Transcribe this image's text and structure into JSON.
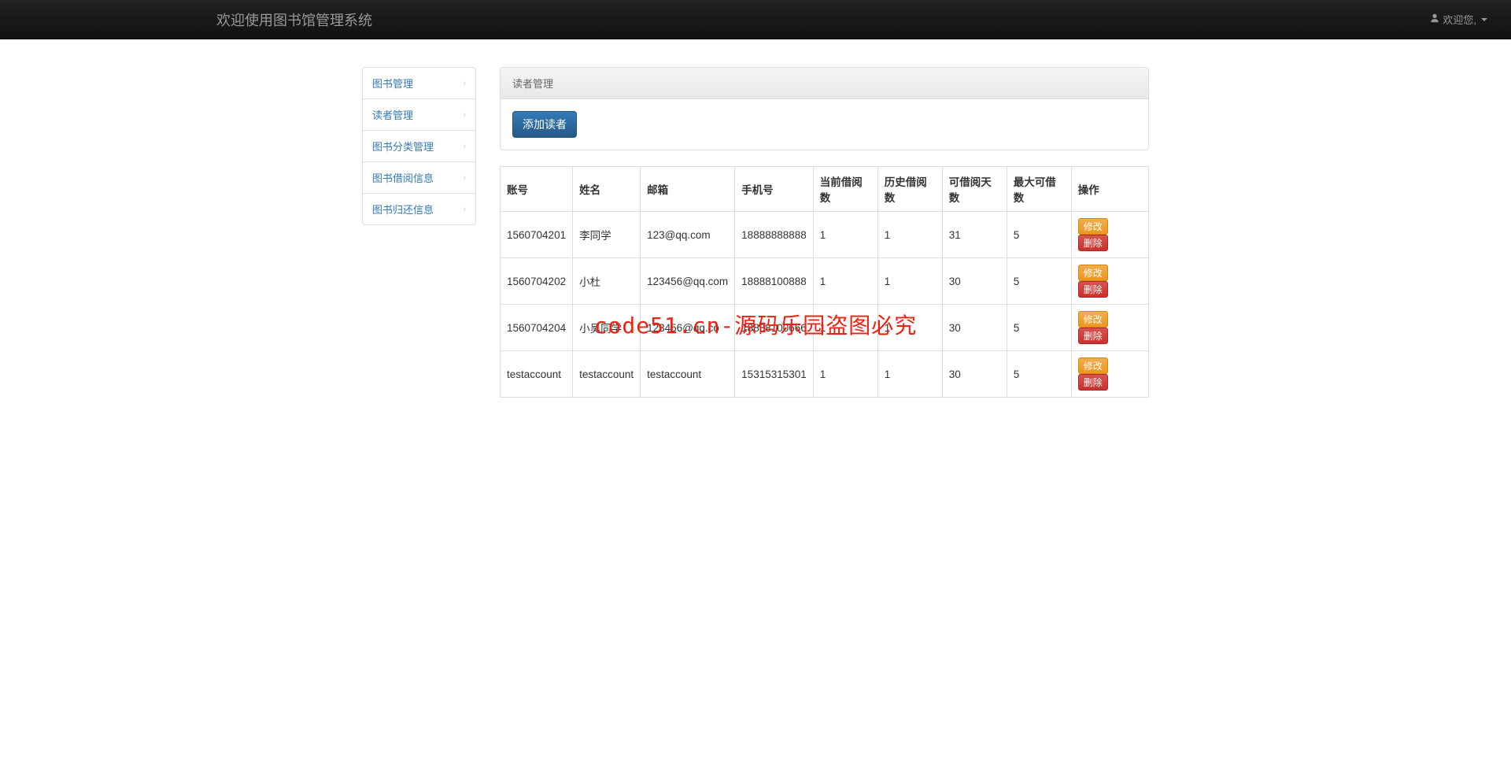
{
  "navbar": {
    "brand": "欢迎使用图书馆管理系统",
    "welcome": "欢迎您,"
  },
  "sidebar": {
    "items": [
      {
        "label": "图书管理"
      },
      {
        "label": "读者管理"
      },
      {
        "label": "图书分类管理"
      },
      {
        "label": "图书借阅信息"
      },
      {
        "label": "图书归还信息"
      }
    ]
  },
  "panel": {
    "title": "读者管理",
    "add_button": "添加读者"
  },
  "table": {
    "headers": [
      "账号",
      "姓名",
      "邮箱",
      "手机号",
      "当前借阅数",
      "历史借阅数",
      "可借阅天数",
      "最大可借数",
      "操作"
    ],
    "edit_label": "修改",
    "delete_label": "删除",
    "rows": [
      {
        "account": "1560704201",
        "name": "李同学",
        "email": "123@qq.com",
        "phone": "18888888888",
        "current": "1",
        "history": "1",
        "days": "31",
        "max": "5"
      },
      {
        "account": "1560704202",
        "name": "小杜",
        "email": "123456@qq.com",
        "phone": "18888100888",
        "current": "1",
        "history": "1",
        "days": "30",
        "max": "5"
      },
      {
        "account": "1560704204",
        "name": "小吴同学",
        "email": "123456@qq.co",
        "phone": "18888100666",
        "current": "1",
        "history": "1",
        "days": "30",
        "max": "5"
      },
      {
        "account": "testaccount",
        "name": "testaccount",
        "email": "testaccount",
        "phone": "15315315301",
        "current": "1",
        "history": "1",
        "days": "30",
        "max": "5"
      }
    ]
  },
  "watermark": "code51.cn-源码乐园盗图必究"
}
